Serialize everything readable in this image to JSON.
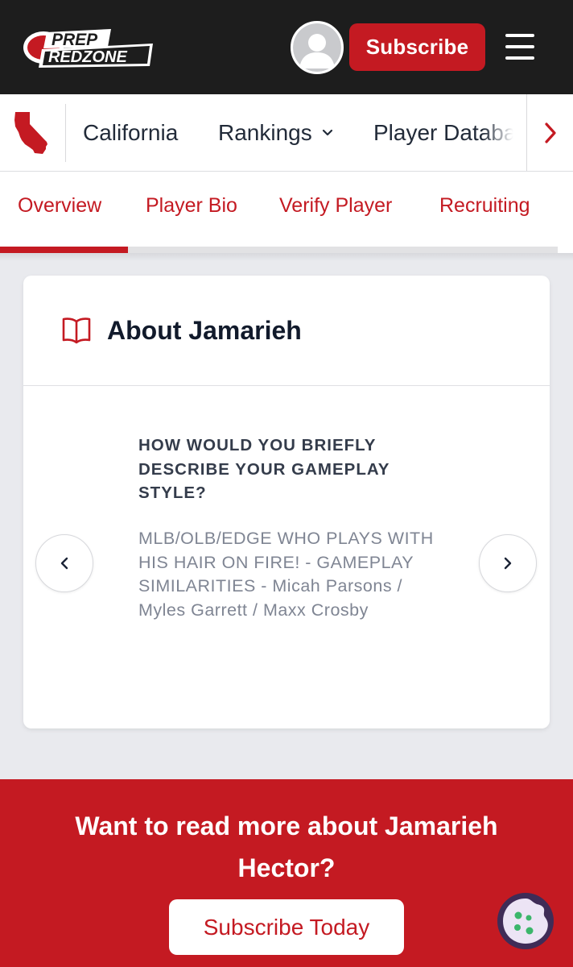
{
  "header": {
    "logo_line1": "PREP",
    "logo_line2": "REDZONE",
    "subscribe_label": "Subscribe"
  },
  "state_nav": {
    "items": [
      {
        "label": "California"
      },
      {
        "label": "Rankings"
      },
      {
        "label": "Player Database"
      }
    ]
  },
  "tabs": [
    {
      "label": "Overview",
      "active": true
    },
    {
      "label": "Player Bio"
    },
    {
      "label": "Verify Player"
    },
    {
      "label": "Recruiting"
    }
  ],
  "about": {
    "title": "About Jamarieh",
    "question": "HOW WOULD YOU BRIEFLY DESCRIBE YOUR GAMEPLAY STYLE?",
    "answer": "MLB/OLB/EDGE WHO PLAYS WITH HIS HAIR ON FIRE! - GAMEPLAY SIMILARITIES - Micah Parsons / Myles Garrett / Maxx Crosby"
  },
  "promo": {
    "text": "Want to read more about Jamarieh Hector?",
    "button_label": "Subscribe Today"
  },
  "colors": {
    "brand_red": "#c41a22",
    "header_bg": "#1d1d1d",
    "page_bg": "#e9eaee"
  }
}
